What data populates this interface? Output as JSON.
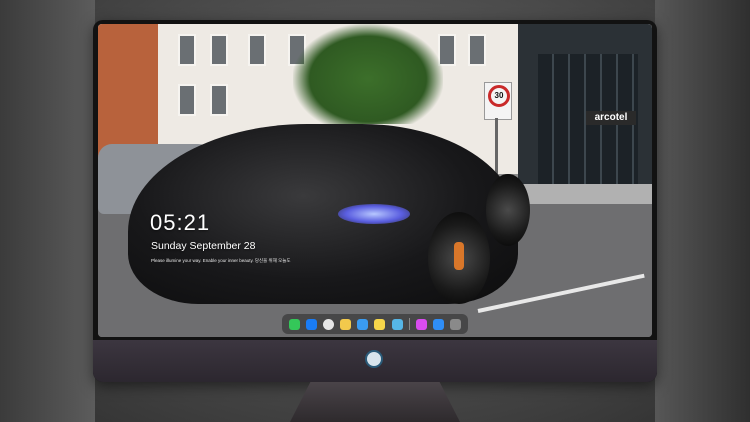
{
  "lockscreen": {
    "time": "05:21",
    "date": "Sunday September  28",
    "note": "Please illumine your way. Enable your inner beauty. 당신을 위해 오늘도"
  },
  "scene": {
    "speed_sign": "30",
    "hotel_sign": "arcotel"
  },
  "dock": {
    "icons": [
      {
        "name": "messages-icon",
        "color": "#34c759"
      },
      {
        "name": "mail-icon",
        "color": "#1a7cf5"
      },
      {
        "name": "safari-icon",
        "color": "#e6e6e6"
      },
      {
        "name": "photos-icon",
        "color": "#f2c94c"
      },
      {
        "name": "clips-icon",
        "color": "#3a9cf2"
      },
      {
        "name": "notes-icon",
        "color": "#f6d64a"
      },
      {
        "name": "preview-icon",
        "color": "#56b6e6"
      },
      {
        "name": "itunes-icon",
        "color": "#d94cf0"
      },
      {
        "name": "appstore-icon",
        "color": "#2f8ef7"
      },
      {
        "name": "camera-icon",
        "color": "#8a8a8a"
      }
    ]
  },
  "colors": {
    "accent": "#2f8ef7",
    "monitor_chin": "#3c3640"
  }
}
